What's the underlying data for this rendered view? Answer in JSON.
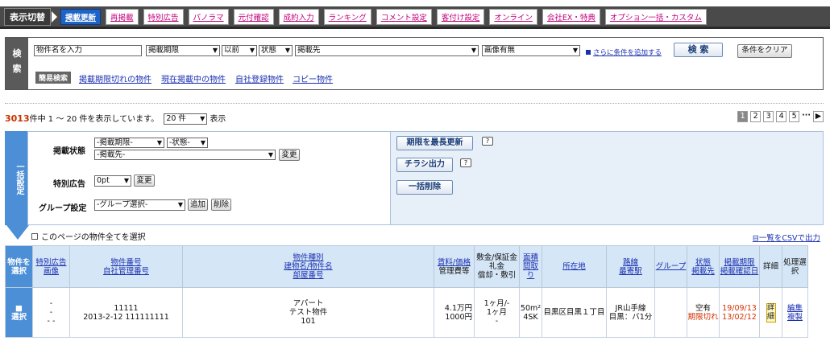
{
  "topnav": {
    "mode_label": "表示切替",
    "items": [
      {
        "label": "掲載更新",
        "active": true
      },
      {
        "label": "再掲載"
      },
      {
        "label": "特別広告"
      },
      {
        "label": "パノラマ"
      },
      {
        "label": "元付確認"
      },
      {
        "label": "成約入力"
      },
      {
        "label": "ランキング"
      },
      {
        "label": "コメント設定"
      },
      {
        "label": "客付け設定"
      },
      {
        "label": "オンライン"
      },
      {
        "label": "会社EX・特典"
      },
      {
        "label": "オプション一括・カスタム"
      }
    ]
  },
  "search": {
    "side_label_1": "検",
    "side_label_2": "索",
    "property_name": "物件名を入力",
    "period": "掲載期限",
    "before_after": "以前",
    "status": "状態",
    "destination": "掲載先",
    "image": "画像有無",
    "add_condition": "さらに条件を追加する",
    "search_button": "検 索",
    "clear_button": "条件をクリア",
    "quick_label": "簡易検索",
    "quick_links": [
      "掲載期限切れの物件",
      "現在掲載中の物件",
      "自社登録物件",
      "コピー物件"
    ]
  },
  "results": {
    "total": "3013",
    "range_text": "件中 1 ～ 20 件を表示しています。",
    "per_page": "20 件",
    "display_label": "表示",
    "pages": [
      "1",
      "2",
      "3",
      "4",
      "5"
    ],
    "ellipsis": "···",
    "next": "▶"
  },
  "bulk": {
    "side_label": "一括設定",
    "status_label": "掲載状態",
    "period_select": "-掲載期限-",
    "status_select": "-状態-",
    "destination_select": "-掲載先-",
    "change_button": "変更",
    "special_label": "特別広告",
    "special_select": "0pt",
    "group_label": "グループ設定",
    "group_select": "-グループ選択-",
    "add_button": "追加",
    "delete_button": "削除",
    "extend_button": "期限を最長更新",
    "flyer_button": "チラシ出力",
    "delete_all_button": "一括削除",
    "help": "?"
  },
  "list": {
    "select_all": "このページの物件全てを選択",
    "csv": "一覧をCSVで出力",
    "headers": {
      "select": "物件を選択",
      "special": "特別広告画像",
      "number": "物件番号",
      "number_sub": "自社管理番号",
      "type": "物件種別",
      "type_sub": "建物名/物件名",
      "type_sub2": "部屋番号",
      "rent": "賃料/価格",
      "rent_sub": "管理費等",
      "deposit": "敷金/保証金",
      "deposit_sub": "礼金",
      "deposit_sub2": "償却・敷引",
      "area": "面積間取り",
      "address": "所在地",
      "line": "路線",
      "line_sub": "最寄駅",
      "group": "グループ",
      "status": "状態",
      "status_sub": "掲載先",
      "period": "掲載期限",
      "period_sub": "掲載確認日",
      "detail": "詳細",
      "action": "処理選択"
    },
    "rows": [
      {
        "select": "選択",
        "special": "-",
        "special2": "-",
        "special3": "- -",
        "number": "11111",
        "mgmt": "2013-2-12 111111111",
        "type": "アパート",
        "name": "テスト物件",
        "room": "101",
        "rent": "4.1万円",
        "fee": "1000円",
        "deposit": "1ヶ月/-",
        "key": "1ヶ月",
        "amort": "-",
        "area": "50m²",
        "layout": "4SK",
        "address": "目黒区目黒１丁目",
        "line": "JR山手線",
        "station": "目黒：バ1分",
        "group": "",
        "status": "空有",
        "status2": "期限切れ",
        "period": "19/09/13",
        "confirm": "13/02/12",
        "detail": "詳細",
        "edit": "編集",
        "copy": "複製"
      }
    ]
  }
}
